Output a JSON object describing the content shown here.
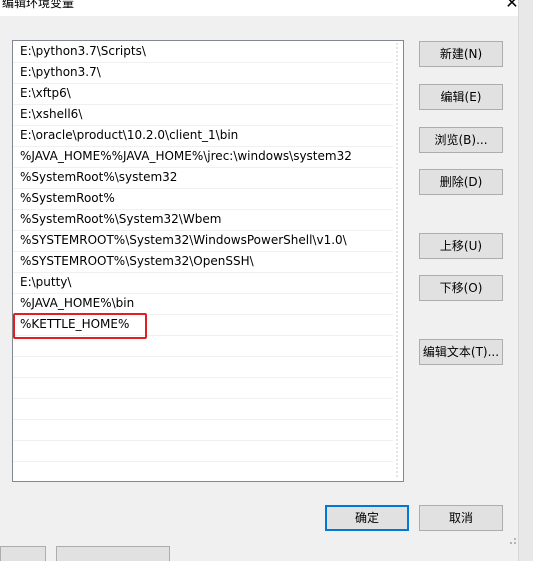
{
  "window": {
    "title": "编辑环境变量",
    "close_symbol": "✕"
  },
  "path_list": {
    "items": [
      "E:\\python3.7\\Scripts\\",
      "E:\\python3.7\\",
      "E:\\xftp6\\",
      "E:\\xshell6\\",
      "E:\\oracle\\product\\10.2.0\\client_1\\bin",
      "%JAVA_HOME%%JAVA_HOME%\\jrec:\\windows\\system32",
      "%SystemRoot%\\system32",
      "%SystemRoot%",
      "%SystemRoot%\\System32\\Wbem",
      "%SYSTEMROOT%\\System32\\WindowsPowerShell\\v1.0\\",
      "%SYSTEMROOT%\\System32\\OpenSSH\\",
      "E:\\putty\\",
      "%JAVA_HOME%\\bin",
      "%KETTLE_HOME%"
    ]
  },
  "buttons": {
    "new": "新建(N)",
    "edit": "编辑(E)",
    "browse": "浏览(B)...",
    "delete": "删除(D)",
    "move_up": "上移(U)",
    "move_down": "下移(O)",
    "edit_text": "编辑文本(T)...",
    "ok": "确定",
    "cancel": "取消"
  },
  "colors": {
    "highlight": "#e02020",
    "default_button_border": "#0078d7"
  }
}
